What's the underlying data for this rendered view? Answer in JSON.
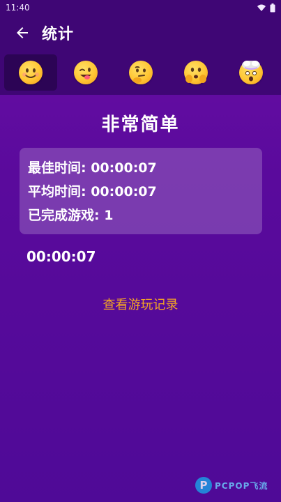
{
  "status_bar": {
    "time": "11:40"
  },
  "toolbar": {
    "title": "统计"
  },
  "tabs": [
    {
      "icon": "smiling-face-icon",
      "active": true
    },
    {
      "icon": "winking-tongue-face-icon",
      "active": false
    },
    {
      "icon": "thinking-face-icon",
      "active": false
    },
    {
      "icon": "peeking-face-icon",
      "active": false
    },
    {
      "icon": "exploding-head-icon",
      "active": false
    }
  ],
  "difficulty": "非常简单",
  "stats": {
    "best_time": "最佳时间: 00:00:07",
    "avg_time": "平均时间: 00:00:07",
    "completed": "已完成游戏: 1"
  },
  "records": [
    "00:00:07"
  ],
  "history_link": "查看游玩记录",
  "watermark": {
    "logo": "P",
    "text": "PCPOP飞流"
  },
  "colors": {
    "header": "#3f0675",
    "background": "#5a0a9c",
    "link": "#f5a623"
  }
}
